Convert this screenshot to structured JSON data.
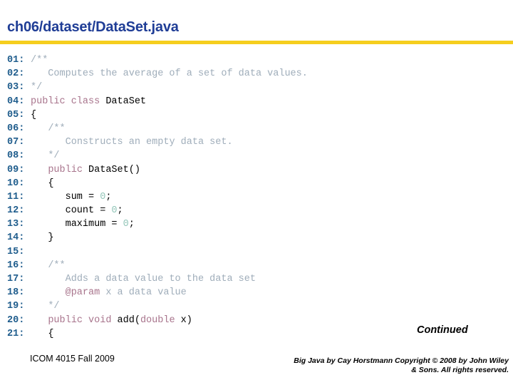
{
  "slide": {
    "title": "ch06/dataset/DataSet.java",
    "title_color": "#1F3D96",
    "rule_color": "#F5CE1E",
    "background_color": "#FFFFFF"
  },
  "syntax_colors": {
    "line_number": "#1E5C8C",
    "comment": "#9FADBA",
    "keyword": "#A8748C",
    "identifier": "#000000",
    "number": "#93C6B9",
    "javadoc_tag": "#A8748C"
  },
  "code": {
    "language": "java",
    "lines": [
      {
        "num": "01:",
        "tokens": [
          {
            "t": "/**",
            "c": "com",
            "indent": 0
          }
        ]
      },
      {
        "num": "02:",
        "tokens": [
          {
            "t": "   Computes the average of a set of data values.",
            "c": "com",
            "indent": 0
          }
        ]
      },
      {
        "num": "03:",
        "tokens": [
          {
            "t": "*/",
            "c": "com",
            "indent": 0
          }
        ]
      },
      {
        "num": "04:",
        "tokens": [
          {
            "t": "public class ",
            "c": "kw",
            "indent": 0
          },
          {
            "t": "DataSet",
            "c": "id"
          }
        ]
      },
      {
        "num": "05:",
        "tokens": [
          {
            "t": "{",
            "c": "punc",
            "indent": 0
          }
        ]
      },
      {
        "num": "06:",
        "tokens": [
          {
            "t": "/**",
            "c": "com",
            "indent": 3
          }
        ]
      },
      {
        "num": "07:",
        "tokens": [
          {
            "t": "   Constructs an empty data set.",
            "c": "com",
            "indent": 3
          }
        ]
      },
      {
        "num": "08:",
        "tokens": [
          {
            "t": "*/",
            "c": "com",
            "indent": 3
          }
        ]
      },
      {
        "num": "09:",
        "tokens": [
          {
            "t": "public ",
            "c": "kw",
            "indent": 3
          },
          {
            "t": "DataSet()",
            "c": "id"
          }
        ]
      },
      {
        "num": "10:",
        "tokens": [
          {
            "t": "{",
            "c": "punc",
            "indent": 3
          }
        ]
      },
      {
        "num": "11:",
        "tokens": [
          {
            "t": "sum = ",
            "c": "id",
            "indent": 6
          },
          {
            "t": "0",
            "c": "num"
          },
          {
            "t": ";",
            "c": "punc"
          }
        ]
      },
      {
        "num": "12:",
        "tokens": [
          {
            "t": "count = ",
            "c": "id",
            "indent": 6
          },
          {
            "t": "0",
            "c": "num"
          },
          {
            "t": ";",
            "c": "punc"
          }
        ]
      },
      {
        "num": "13:",
        "tokens": [
          {
            "t": "maximum = ",
            "c": "id",
            "indent": 6
          },
          {
            "t": "0",
            "c": "num"
          },
          {
            "t": ";",
            "c": "punc"
          }
        ]
      },
      {
        "num": "14:",
        "tokens": [
          {
            "t": "}",
            "c": "punc",
            "indent": 3
          }
        ]
      },
      {
        "num": "15:",
        "tokens": []
      },
      {
        "num": "16:",
        "tokens": [
          {
            "t": "/**",
            "c": "com",
            "indent": 3
          }
        ]
      },
      {
        "num": "17:",
        "tokens": [
          {
            "t": "   Adds a data value to the data set",
            "c": "com",
            "indent": 3
          }
        ]
      },
      {
        "num": "18:",
        "tokens": [
          {
            "t": "@param",
            "c": "tag",
            "indent": 6
          },
          {
            "t": " x a data value",
            "c": "com"
          }
        ]
      },
      {
        "num": "19:",
        "tokens": [
          {
            "t": "*/",
            "c": "com",
            "indent": 3
          }
        ]
      },
      {
        "num": "20:",
        "tokens": [
          {
            "t": "public void ",
            "c": "kw",
            "indent": 3
          },
          {
            "t": "add(",
            "c": "id"
          },
          {
            "t": "double",
            "c": "kw"
          },
          {
            "t": " x)",
            "c": "id"
          }
        ]
      },
      {
        "num": "21:",
        "tokens": [
          {
            "t": "{",
            "c": "punc",
            "indent": 3
          }
        ]
      }
    ]
  },
  "continued": {
    "label": "Continued"
  },
  "footer": {
    "course": "ICOM 4015 Fall 2009",
    "copyright_line1": "Big Java by Cay Horstmann Copyright © 2008 by John Wiley",
    "copyright_line2": "& Sons.  All rights reserved."
  }
}
